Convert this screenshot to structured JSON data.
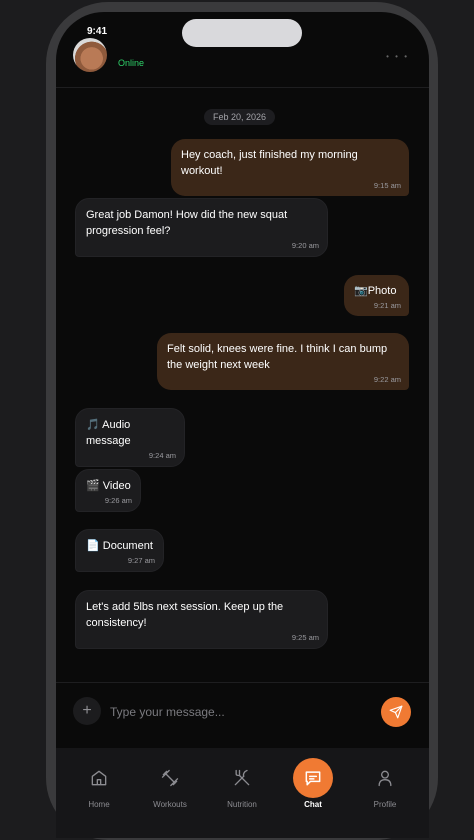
{
  "status_bar": {
    "time": "9:41"
  },
  "header": {
    "presence": "Online",
    "action_text": "• • •"
  },
  "conversation": {
    "date_divider": "Feb 20, 2026",
    "messages": [
      {
        "side": "sent",
        "text": "Hey coach, just finished my morning workout!",
        "time": "9:15 am"
      },
      {
        "side": "received",
        "text": "Great job Damon! How did the new squat progression feel?",
        "time": "9:20 am"
      },
      {
        "side": "sent",
        "icon": "camera-icon",
        "text": "📷Photo",
        "time": "9:21 am"
      },
      {
        "side": "sent",
        "text": "Felt solid, knees were fine. I think I can bump the weight next week",
        "time": "9:22 am"
      },
      {
        "side": "received",
        "icon": "music-note-icon",
        "text": "🎵 Audio message",
        "time": "9:24 am"
      },
      {
        "side": "received",
        "icon": "clapperboard-icon",
        "text": "🎬 Video",
        "time": "9:26 am"
      },
      {
        "side": "received",
        "icon": "document-icon",
        "text": "📄 Document",
        "time": "9:27 am"
      },
      {
        "side": "received",
        "text": "Let's add 5lbs next session. Keep up the consistency!",
        "time": "9:25 am"
      }
    ]
  },
  "composer": {
    "placeholder": "Type your message...",
    "value": "",
    "attach_icon": "plus-icon",
    "send_icon": "send-icon"
  },
  "tabbar": {
    "tabs": [
      {
        "label": "Home",
        "icon": "home-icon",
        "active": false
      },
      {
        "label": "Workouts",
        "icon": "dumbbell-icon",
        "active": false
      },
      {
        "label": "Nutrition",
        "icon": "fork-knife-icon",
        "active": false
      },
      {
        "label": "Chat",
        "icon": "chat-bubble-icon",
        "active": true
      },
      {
        "label": "Profile",
        "icon": "user-icon",
        "active": false
      }
    ]
  },
  "colors": {
    "accent": "#f07a33",
    "sent_bubble": "#3b2718",
    "received_bubble": "#1c1c1e",
    "online": "#2fd26a"
  }
}
